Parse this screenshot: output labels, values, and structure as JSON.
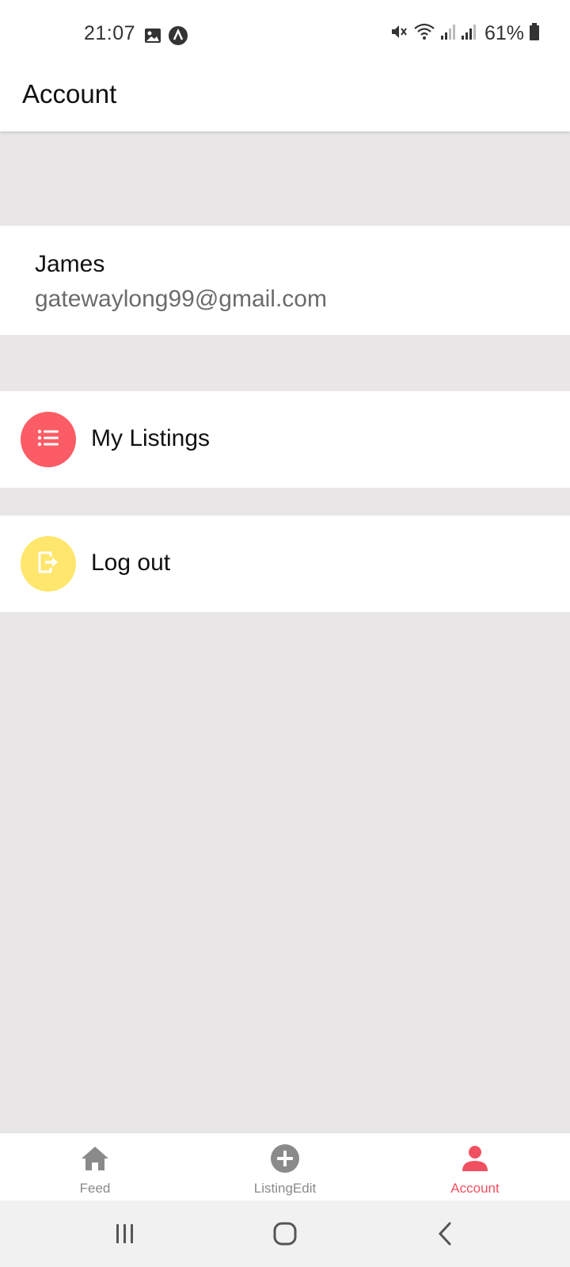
{
  "status_bar": {
    "time": "21:07",
    "battery": "61%",
    "left_icons": [
      "gallery-icon",
      "app-notification-icon"
    ],
    "right_icons": [
      "mute-icon",
      "wifi-icon",
      "signal-icon",
      "signal-icon",
      "battery-icon"
    ]
  },
  "app_bar": {
    "title": "Account"
  },
  "profile": {
    "name": "James",
    "email": "gatewaylong99@gmail.com"
  },
  "menu": [
    {
      "label": "My Listings",
      "icon": "list-icon",
      "color": "#fc5c65"
    },
    {
      "label": "Log out",
      "icon": "logout-icon",
      "color": "#ffe66d"
    }
  ],
  "tabs": [
    {
      "label": "Feed",
      "icon": "home-icon",
      "active": false
    },
    {
      "label": "ListingEdit",
      "icon": "plus-circle-icon",
      "active": false
    },
    {
      "label": "Account",
      "icon": "account-icon",
      "active": true
    }
  ],
  "colors": {
    "accent": "#f0505f",
    "inactive": "#8a8a8a",
    "background": "#e8e6e7"
  },
  "system_nav": [
    "recents-icon",
    "home-button-icon",
    "back-icon"
  ]
}
